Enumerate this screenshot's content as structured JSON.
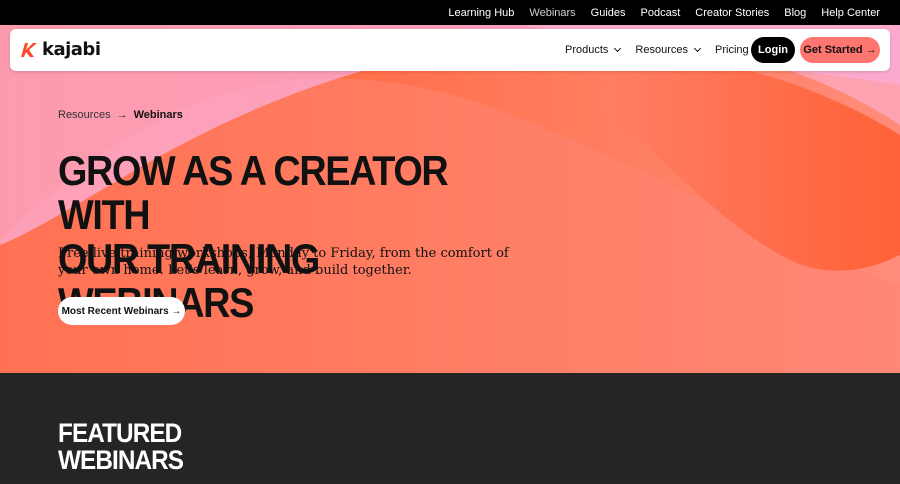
{
  "topbar": {
    "items": [
      "Learning Hub",
      "Webinars",
      "Guides",
      "Podcast",
      "Creator Stories",
      "Blog",
      "Help Center"
    ],
    "active": "Webinars"
  },
  "navbar": {
    "logo_text": "kajabi",
    "links": [
      {
        "label": "Products",
        "dropdown": true
      },
      {
        "label": "Resources",
        "dropdown": true
      },
      {
        "label": "Pricing",
        "dropdown": false
      }
    ],
    "login_label": "Login",
    "get_started_label": "Get Started →"
  },
  "breadcrumb": {
    "parent": "Resources",
    "separator": "→",
    "current": "Webinars"
  },
  "hero": {
    "title_line1": "GROW AS A CREATOR WITH",
    "title_line2": "OUR TRAINING WEBINARS",
    "subtitle": "Free live training workshops, Monday to Friday, from the comfort of your own home. Let's learn, grow, and build together.",
    "cta_label": "Most Recent Webinars →"
  },
  "featured": {
    "line1": "FEATURED",
    "line2": "WEBINARS"
  },
  "colors": {
    "accent": "#ff7570",
    "orange": "#ff5a2c",
    "pink": "#f9a6dd",
    "dark": "#262525"
  }
}
